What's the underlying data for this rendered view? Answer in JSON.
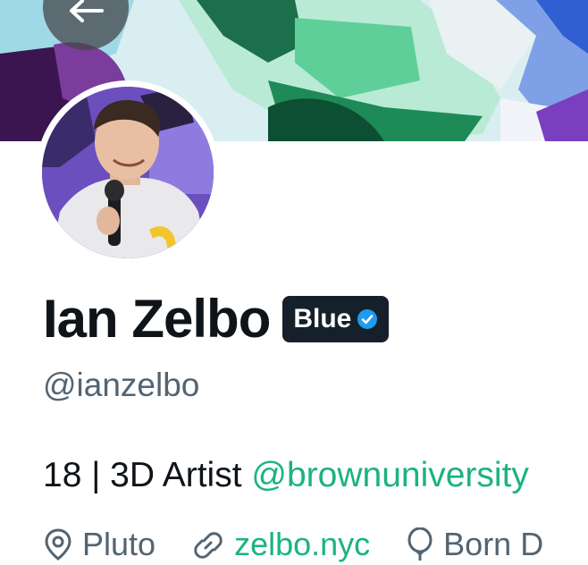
{
  "profile": {
    "display_name": "Ian Zelbo",
    "badge_label": "Blue",
    "handle": "@ianzelbo",
    "bio_text": "18 | 3D Artist ",
    "bio_mention": "@brownuniversity",
    "location": "Pluto",
    "website": "zelbo.nyc",
    "birth": "Born D"
  },
  "colors": {
    "accent": "#1cb37e",
    "verified": "#1d9bf0",
    "badge_bg": "#15202b",
    "secondary_text": "#536471"
  },
  "icons": {
    "back": "arrow-left-icon",
    "verified": "verified-check-icon",
    "location": "location-pin-icon",
    "link": "link-icon",
    "birthday": "balloon-icon"
  }
}
